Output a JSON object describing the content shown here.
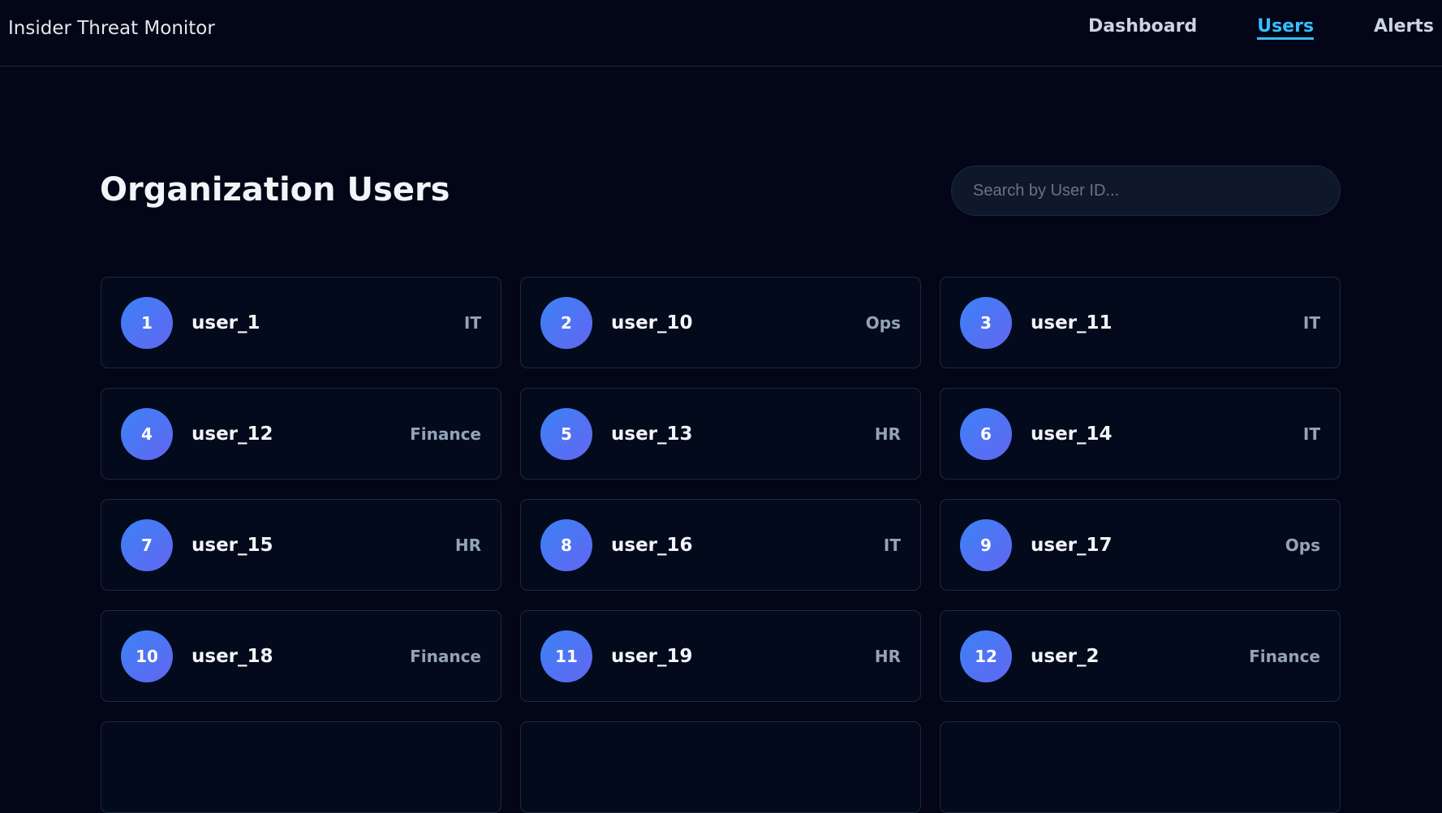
{
  "header": {
    "brand": "Insider Threat Monitor",
    "nav": [
      {
        "label": "Dashboard"
      },
      {
        "label": "Users"
      },
      {
        "label": "Alerts"
      }
    ]
  },
  "main": {
    "title": "Organization Users",
    "search": {
      "placeholder": "Search by User ID...",
      "value": ""
    },
    "users": [
      {
        "index": "1",
        "name": "user_1",
        "department": "IT"
      },
      {
        "index": "2",
        "name": "user_10",
        "department": "Ops"
      },
      {
        "index": "3",
        "name": "user_11",
        "department": "IT"
      },
      {
        "index": "4",
        "name": "user_12",
        "department": "Finance"
      },
      {
        "index": "5",
        "name": "user_13",
        "department": "HR"
      },
      {
        "index": "6",
        "name": "user_14",
        "department": "IT"
      },
      {
        "index": "7",
        "name": "user_15",
        "department": "HR"
      },
      {
        "index": "8",
        "name": "user_16",
        "department": "IT"
      },
      {
        "index": "9",
        "name": "user_17",
        "department": "Ops"
      },
      {
        "index": "10",
        "name": "user_18",
        "department": "Finance"
      },
      {
        "index": "11",
        "name": "user_19",
        "department": "HR"
      },
      {
        "index": "12",
        "name": "user_2",
        "department": "Finance"
      }
    ]
  },
  "colors": {
    "background": "#020617",
    "accent": "#38bdf8",
    "avatar_gradient_start": "#3b82f6",
    "avatar_gradient_end": "#6366f1"
  }
}
